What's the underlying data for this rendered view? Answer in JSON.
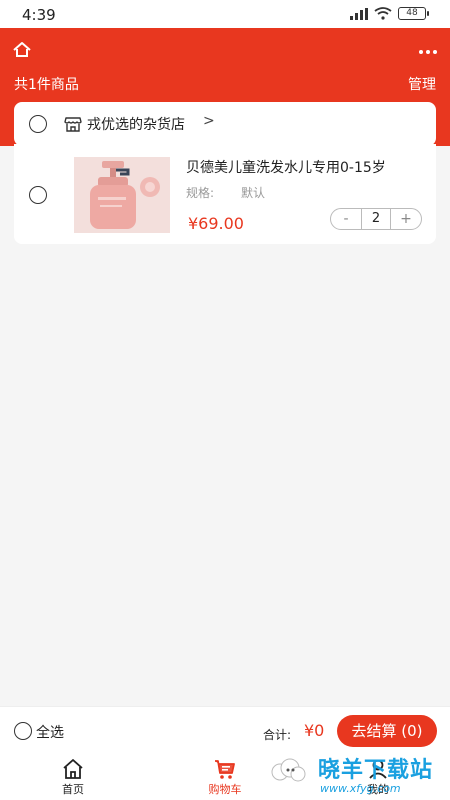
{
  "status_bar": {
    "time": "4:39",
    "battery": "48"
  },
  "header": {
    "count_text": "共1件商品",
    "manage_label": "管理"
  },
  "shop": {
    "name": "戎优选的杂货店",
    "arrow": ">"
  },
  "cart_item": {
    "title": "贝德美儿童洗发水儿专用0-15岁",
    "spec_label": "规格:",
    "spec_value": "默认",
    "price": "¥69.00",
    "quantity": "2",
    "minus": "-",
    "plus": "+"
  },
  "checkout": {
    "select_all_label": "全选",
    "total_label": "合计:",
    "total_value": "¥0",
    "button_label": "去结算 (0)"
  },
  "tabs": [
    {
      "label": "首页",
      "icon": "home-icon",
      "active": false
    },
    {
      "label": "购物车",
      "icon": "cart-icon",
      "active": true
    },
    {
      "label": "我的",
      "icon": "user-icon",
      "active": false
    }
  ],
  "watermark": {
    "text": "晓羊下载站",
    "url": "www.xfyg.com"
  },
  "colors": {
    "brand": "#e8371f",
    "background": "#f5f5f5",
    "watermark": "#1aa0e0"
  }
}
